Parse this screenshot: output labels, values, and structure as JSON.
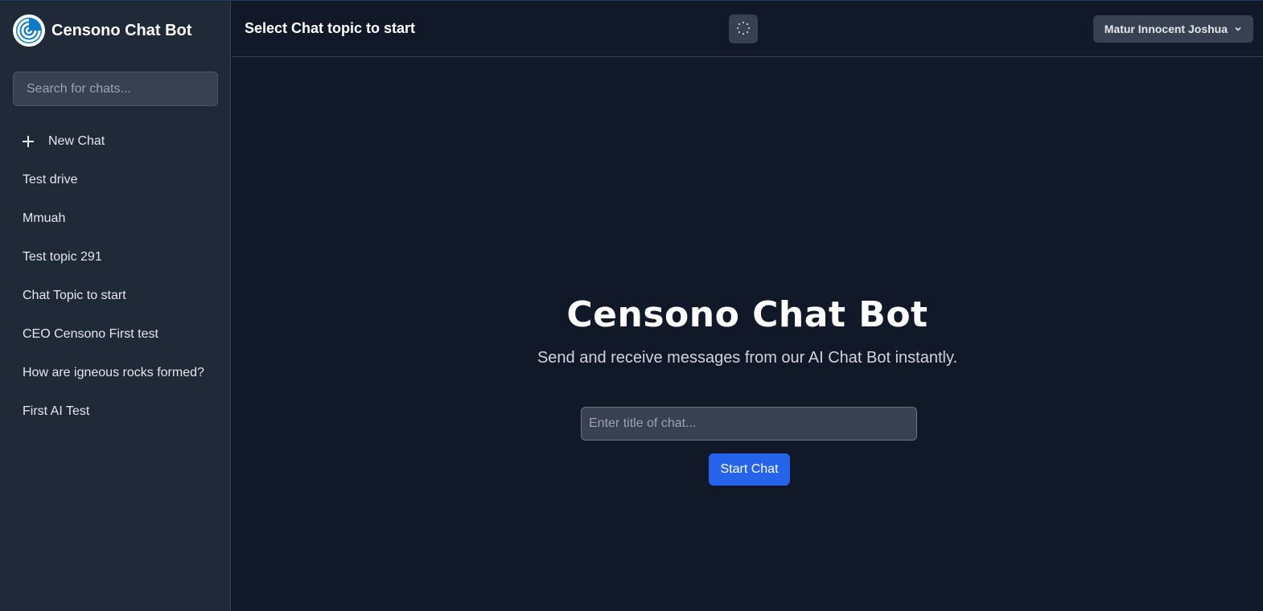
{
  "sidebar": {
    "brand_name": "Censono Chat Bot",
    "search_placeholder": "Search for chats...",
    "new_chat_label": "New Chat",
    "topics": [
      "Test drive",
      "Mmuah",
      "Test topic 291",
      "Chat Topic to start",
      "CEO Censono First test",
      "How are igneous rocks formed?",
      "First AI Test"
    ]
  },
  "header": {
    "title": "Select Chat topic to start",
    "theme_toggle_icon": "sun-icon",
    "user_name": "Matur Innocent Joshua"
  },
  "main": {
    "title": "Censono Chat Bot",
    "subtitle": "Send and receive messages from our AI Chat Bot instantly.",
    "input_placeholder": "Enter title of chat...",
    "start_button_label": "Start Chat"
  },
  "colors": {
    "background": "#111827",
    "sidebar": "#1f2937",
    "accent": "#2563eb",
    "logo_blue": "#0b7bc4"
  }
}
